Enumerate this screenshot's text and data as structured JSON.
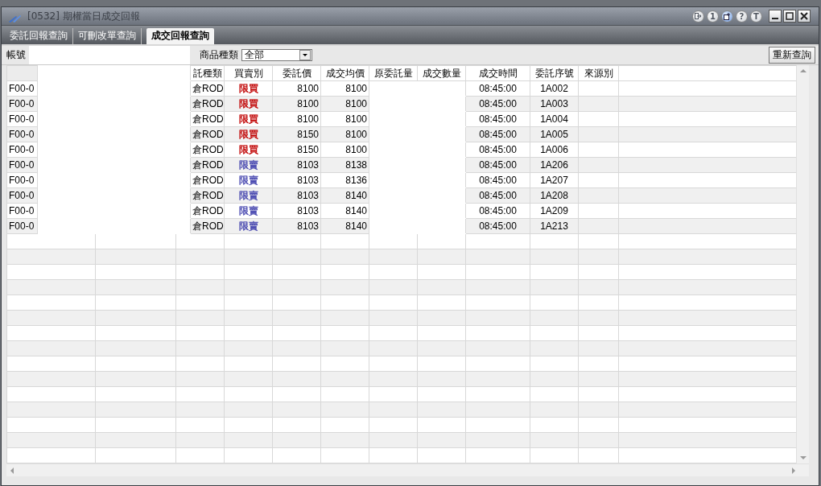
{
  "window": {
    "title": "[0532] 期權當日成交回報",
    "tool_buttons": [
      {
        "kind": "exit"
      },
      {
        "kind": "text",
        "label": "1"
      },
      {
        "kind": "add"
      },
      {
        "kind": "text",
        "label": "?"
      },
      {
        "kind": "text",
        "label": "T"
      }
    ]
  },
  "tabs": [
    {
      "label": "委託回報查詢",
      "selected": false
    },
    {
      "label": "可刪改單查詢",
      "selected": false
    },
    {
      "label": "成交回報查詢",
      "selected": true
    }
  ],
  "query_bar": {
    "account_label": "帳號",
    "product_label": "商品種類",
    "product_value": "全部",
    "requery_button": "重新查詢"
  },
  "table": {
    "columns": [
      {},
      {
        "label": "託種類"
      },
      {
        "label": "買賣別"
      },
      {
        "label": "委託價"
      },
      {
        "label": "成交均價"
      },
      {
        "label": "原委託量"
      },
      {
        "label": "成交數量"
      },
      {
        "label": "成交時間"
      },
      {
        "label": "委託序號"
      },
      {
        "label": "來源別"
      }
    ],
    "rows": [
      {
        "account": "F00-0",
        "order_type": "倉ROD",
        "side": "限買",
        "color": "#c00000",
        "price": "8100",
        "avg_price": "8100",
        "time": "08:45:00",
        "seq": "1A002"
      },
      {
        "account": "F00-0",
        "order_type": "倉ROD",
        "side": "限買",
        "color": "#c00000",
        "price": "8100",
        "avg_price": "8100",
        "time": "08:45:00",
        "seq": "1A003"
      },
      {
        "account": "F00-0",
        "order_type": "倉ROD",
        "side": "限買",
        "color": "#c00000",
        "price": "8100",
        "avg_price": "8100",
        "time": "08:45:00",
        "seq": "1A004"
      },
      {
        "account": "F00-0",
        "order_type": "倉ROD",
        "side": "限買",
        "color": "#c00000",
        "price": "8150",
        "avg_price": "8100",
        "time": "08:45:00",
        "seq": "1A005"
      },
      {
        "account": "F00-0",
        "order_type": "倉ROD",
        "side": "限買",
        "color": "#c00000",
        "price": "8150",
        "avg_price": "8100",
        "time": "08:45:00",
        "seq": "1A006"
      },
      {
        "account": "F00-0",
        "order_type": "倉ROD",
        "side": "限賣",
        "color": "#4848b0",
        "price": "8103",
        "avg_price": "8138",
        "time": "08:45:00",
        "seq": "1A206"
      },
      {
        "account": "F00-0",
        "order_type": "倉ROD",
        "side": "限賣",
        "color": "#4848b0",
        "price": "8103",
        "avg_price": "8136",
        "time": "08:45:00",
        "seq": "1A207"
      },
      {
        "account": "F00-0",
        "order_type": "倉ROD",
        "side": "限賣",
        "color": "#4848b0",
        "price": "8103",
        "avg_price": "8140",
        "time": "08:45:00",
        "seq": "1A208"
      },
      {
        "account": "F00-0",
        "order_type": "倉ROD",
        "side": "限賣",
        "color": "#4848b0",
        "price": "8103",
        "avg_price": "8140",
        "time": "08:45:00",
        "seq": "1A209"
      },
      {
        "account": "F00-0",
        "order_type": "倉ROD",
        "side": "限賣",
        "color": "#4848b0",
        "price": "8103",
        "avg_price": "8140",
        "time": "08:45:00",
        "seq": "1A213"
      }
    ]
  }
}
